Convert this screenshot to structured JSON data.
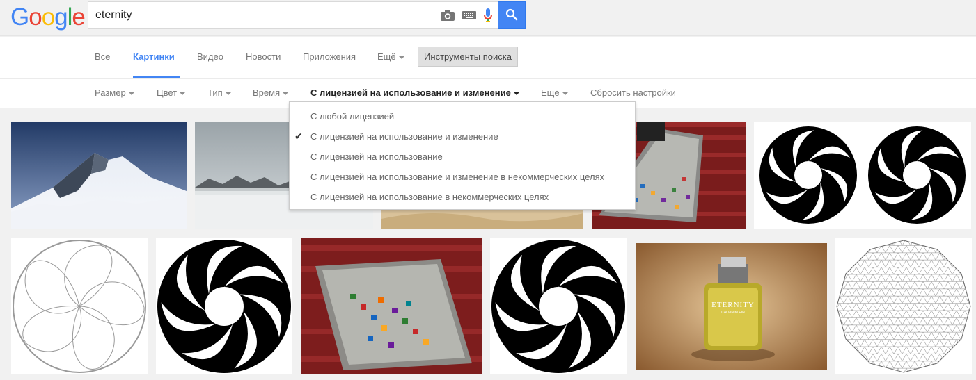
{
  "logo": {
    "letters": [
      "G",
      "o",
      "o",
      "g",
      "l",
      "e"
    ],
    "colors": [
      "#4285f4",
      "#ea4335",
      "#fbbc05",
      "#4285f4",
      "#34a853",
      "#ea4335"
    ]
  },
  "search": {
    "query": "eternity",
    "button_icon": "search-icon"
  },
  "tabs": [
    {
      "label": "Все"
    },
    {
      "label": "Картинки"
    },
    {
      "label": "Видео"
    },
    {
      "label": "Новости"
    },
    {
      "label": "Приложения"
    },
    {
      "label": "Ещё"
    }
  ],
  "tools_label": "Инструменты поиска",
  "filters": [
    {
      "label": "Размер"
    },
    {
      "label": "Цвет"
    },
    {
      "label": "Тип"
    },
    {
      "label": "Время"
    },
    {
      "label": "С лицензией на использование и изменение"
    },
    {
      "label": "Ещё"
    },
    {
      "label": "Сбросить настройки"
    }
  ],
  "license_menu": {
    "items": [
      {
        "label": "С любой лицензией"
      },
      {
        "label": "С лицензией на использование и изменение",
        "selected": true
      },
      {
        "label": "С лицензией на использование"
      },
      {
        "label": "С лицензией на использование и изменение в некоммерческих целях"
      },
      {
        "label": "С лицензией на использование в некоммерческих целях"
      }
    ],
    "check_icon": "checkmark-icon"
  },
  "bottle_label": {
    "brand": "ETERNITY",
    "sub": "CALVIN KLEIN"
  },
  "colors": {
    "accent": "#4285f4",
    "page_bg": "#f1f1f1"
  }
}
